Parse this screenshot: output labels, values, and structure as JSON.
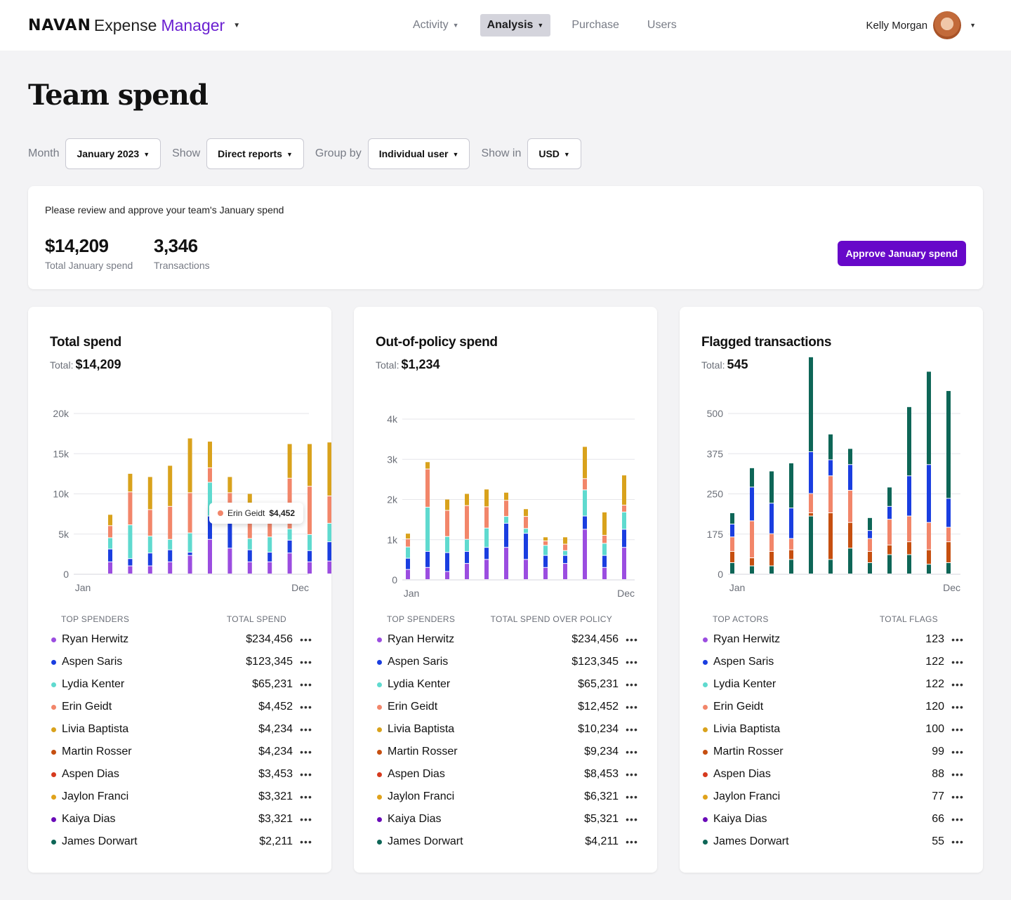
{
  "topbar": {
    "brand_logo": "NAVAN",
    "brand_expense": "Expense",
    "brand_manager": "Manager",
    "nav": [
      "Activity",
      "Analysis",
      "Purchase",
      "Users"
    ],
    "active_nav": "Analysis",
    "user_name": "Kelly Morgan"
  },
  "page_title": "Team spend",
  "filters": {
    "month_label": "Month",
    "month_value": "January 2023",
    "show_label": "Show",
    "show_value": "Direct reports",
    "group_label": "Group by",
    "group_value": "Individual user",
    "currency_label": "Show in",
    "currency_value": "USD"
  },
  "summary": {
    "note": "Please review and approve your team's January spend",
    "total_value": "$14,209",
    "total_label": "Total January spend",
    "tx_value": "3,346",
    "tx_label": "Transactions",
    "approve_label": "Approve January spend"
  },
  "colors": {
    "Ryan Herwitz": "#9b4de0",
    "Aspen Saris": "#1a3ee0",
    "Lydia Kenter": "#5fdacf",
    "Erin Geidt": "#f2866a",
    "Livia Baptista": "#d9a21c",
    "Martin Rosser": "#c64f10",
    "Aspen Dias": "#d63a1e",
    "Jaylon Franci": "#e0a21b",
    "Kaiya Dias": "#6a0bb8",
    "James Dorwart": "#0e6657"
  },
  "cards": [
    {
      "title": "Total spend",
      "total_label": "Total:",
      "total_value": "$14,209",
      "list_head_left": "TOP SPENDERS",
      "list_head_right": "TOTAL SPEND",
      "rows": [
        {
          "name": "Ryan Herwitz",
          "value": "$234,456"
        },
        {
          "name": "Aspen Saris",
          "value": "$123,345"
        },
        {
          "name": "Lydia Kenter",
          "value": "$65,231"
        },
        {
          "name": "Erin Geidt",
          "value": "$4,452"
        },
        {
          "name": "Livia Baptista",
          "value": "$4,234"
        },
        {
          "name": "Martin Rosser",
          "value": "$4,234"
        },
        {
          "name": "Aspen Dias",
          "value": "$3,453"
        },
        {
          "name": "Jaylon Franci",
          "value": "$3,321"
        },
        {
          "name": "Kaiya Dias",
          "value": "$3,321"
        },
        {
          "name": "James Dorwart",
          "value": "$2,211"
        }
      ],
      "tooltip": {
        "name": "Erin Geidt",
        "value": "$4,452"
      }
    },
    {
      "title": "Out-of-policy spend",
      "total_label": "Total:",
      "total_value": "$1,234",
      "list_head_left": "TOP SPENDERS",
      "list_head_right": "TOTAL SPEND OVER POLICY",
      "rows": [
        {
          "name": "Ryan Herwitz",
          "value": "$234,456"
        },
        {
          "name": "Aspen Saris",
          "value": "$123,345"
        },
        {
          "name": "Lydia Kenter",
          "value": "$65,231"
        },
        {
          "name": "Erin Geidt",
          "value": "$12,452"
        },
        {
          "name": "Livia Baptista",
          "value": "$10,234"
        },
        {
          "name": "Martin Rosser",
          "value": "$9,234"
        },
        {
          "name": "Aspen Dias",
          "value": "$8,453"
        },
        {
          "name": "Jaylon Franci",
          "value": "$6,321"
        },
        {
          "name": "Kaiya Dias",
          "value": "$5,321"
        },
        {
          "name": "James Dorwart",
          "value": "$4,211"
        }
      ]
    },
    {
      "title": "Flagged transactions",
      "total_label": "Total:",
      "total_value": "545",
      "list_head_left": "TOP ACTORS",
      "list_head_right": "TOTAL FLAGS",
      "rows": [
        {
          "name": "Ryan Herwitz",
          "value": "123"
        },
        {
          "name": "Aspen Saris",
          "value": "122"
        },
        {
          "name": "Lydia Kenter",
          "value": "122"
        },
        {
          "name": "Erin Geidt",
          "value": "120"
        },
        {
          "name": "Livia Baptista",
          "value": "100"
        },
        {
          "name": "Martin Rosser",
          "value": "99"
        },
        {
          "name": "Aspen Dias",
          "value": "88"
        },
        {
          "name": "Jaylon Franci",
          "value": "77"
        },
        {
          "name": "Kaiya Dias",
          "value": "66"
        },
        {
          "name": "James Dorwart",
          "value": "55"
        }
      ]
    }
  ],
  "chart_data": [
    {
      "type": "bar",
      "stacked": true,
      "title": "Total spend",
      "x_tick_labels": [
        "Jan",
        "Dec"
      ],
      "y_ticks": [
        "0",
        "5k",
        "10k",
        "15k",
        "20k"
      ],
      "ylim": [
        0,
        20000
      ],
      "grid": true,
      "categories": [
        "1",
        "2",
        "3",
        "4",
        "5",
        "6",
        "7",
        "8",
        "9",
        "10",
        "11",
        "12"
      ],
      "series": [
        {
          "name": "Ryan Herwitz",
          "values": [
            1500,
            1000,
            1000,
            1500,
            2300,
            4300,
            3200,
            1500,
            1500,
            2600,
            1500,
            1600
          ]
        },
        {
          "name": "Aspen Saris",
          "values": [
            1600,
            900,
            1600,
            1500,
            400,
            2900,
            3500,
            1500,
            1200,
            1600,
            1400,
            2400
          ]
        },
        {
          "name": "Lydia Kenter",
          "values": [
            1400,
            4200,
            2100,
            1300,
            2400,
            4200,
            1200,
            1400,
            1900,
            1400,
            2000,
            2300
          ]
        },
        {
          "name": "Erin Geidt",
          "values": [
            1500,
            4100,
            3300,
            4100,
            5000,
            1800,
            2200,
            2500,
            2000,
            6300,
            6000,
            3400
          ]
        },
        {
          "name": "Livia Baptista",
          "values": [
            1400,
            2300,
            4100,
            5100,
            6800,
            3300,
            2000,
            3100,
            2100,
            4300,
            5300,
            6700
          ]
        }
      ]
    },
    {
      "type": "bar",
      "stacked": true,
      "title": "Out-of-policy spend",
      "x_tick_labels": [
        "Jan",
        "Dec"
      ],
      "y_ticks": [
        "0",
        "1k",
        "2k",
        "3k",
        "4k"
      ],
      "ylim": [
        0,
        4000
      ],
      "grid": true,
      "categories": [
        "1",
        "2",
        "3",
        "4",
        "5",
        "6",
        "7",
        "8",
        "9",
        "10",
        "11",
        "12"
      ],
      "series": [
        {
          "name": "Ryan Herwitz",
          "values": [
            250,
            300,
            200,
            400,
            500,
            800,
            500,
            300,
            400,
            1250,
            300,
            800
          ]
        },
        {
          "name": "Aspen Saris",
          "values": [
            280,
            400,
            470,
            300,
            300,
            600,
            650,
            300,
            200,
            330,
            300,
            450
          ]
        },
        {
          "name": "Lydia Kenter",
          "values": [
            280,
            1100,
            400,
            300,
            480,
            170,
            120,
            250,
            120,
            650,
            300,
            430
          ]
        },
        {
          "name": "Erin Geidt",
          "values": [
            200,
            950,
            650,
            840,
            530,
            400,
            300,
            110,
            160,
            280,
            200,
            170
          ]
        },
        {
          "name": "Livia Baptista",
          "values": [
            140,
            180,
            280,
            300,
            440,
            200,
            190,
            100,
            180,
            800,
            580,
            750
          ]
        }
      ]
    },
    {
      "type": "bar",
      "stacked": true,
      "title": "Flagged transactions",
      "x_tick_labels": [
        "Jan",
        "Dec"
      ],
      "y_ticks": [
        "0",
        "175",
        "250",
        "375",
        "500"
      ],
      "grid": true,
      "categories": [
        "1",
        "2",
        "3",
        "4",
        "5",
        "6",
        "7",
        "8",
        "9",
        "10",
        "11",
        "12"
      ],
      "series": [
        {
          "name": "James Dorwart",
          "values": [
            35,
            25,
            25,
            45,
            180,
            45,
            80,
            35,
            60,
            60,
            30,
            35
          ]
        },
        {
          "name": "Martin Rosser",
          "values": [
            35,
            25,
            45,
            30,
            10,
            145,
            80,
            35,
            30,
            40,
            45,
            65
          ]
        },
        {
          "name": "Erin Geidt",
          "values": [
            45,
            115,
            55,
            35,
            60,
            115,
            100,
            40,
            80,
            80,
            85,
            45
          ]
        },
        {
          "name": "Aspen Saris",
          "values": [
            40,
            105,
            95,
            95,
            130,
            50,
            80,
            25,
            40,
            125,
            180,
            90
          ]
        },
        {
          "name": "James Dorwart (top)",
          "values": [
            35,
            60,
            100,
            140,
            295,
            80,
            50,
            40,
            60,
            215,
            290,
            335
          ]
        }
      ]
    }
  ]
}
